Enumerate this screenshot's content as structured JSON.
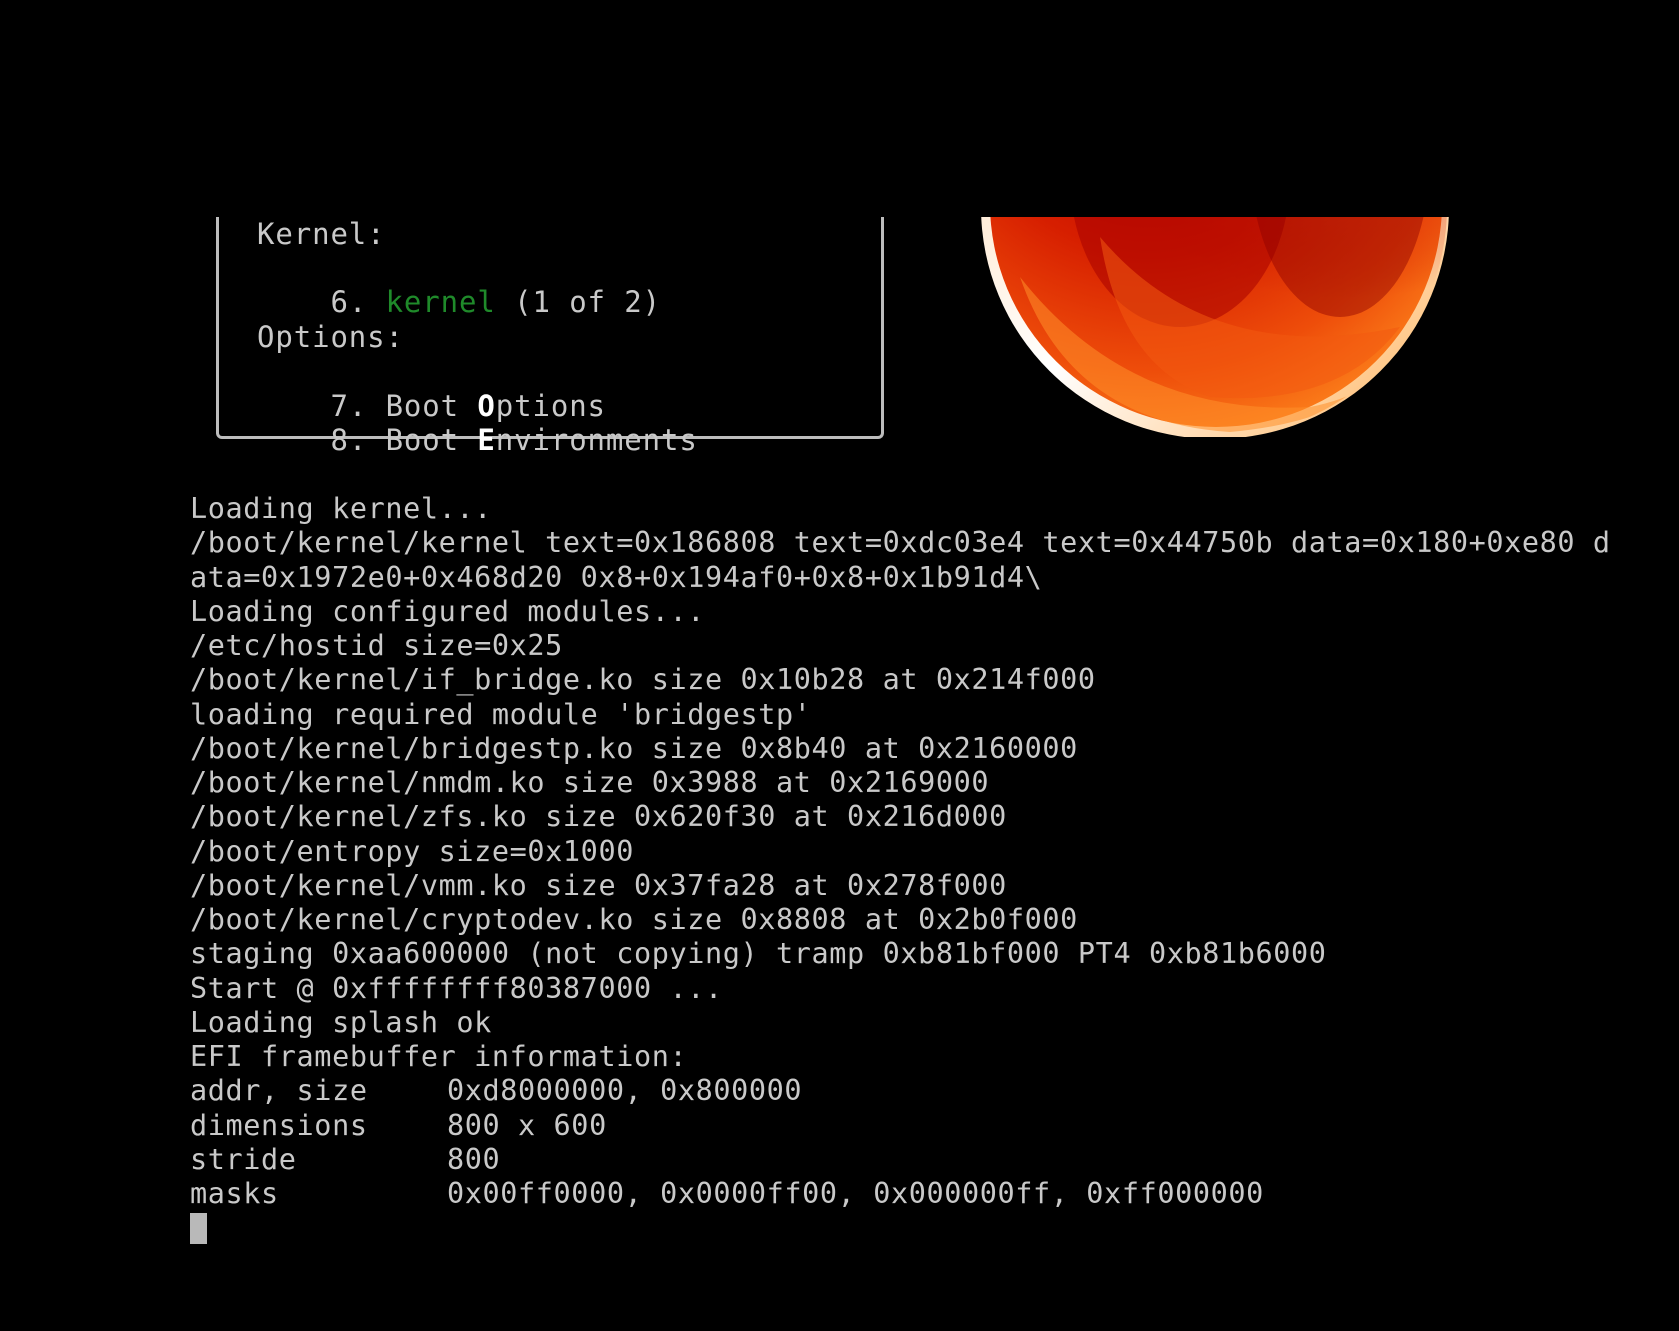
{
  "menu": {
    "kernel_heading": "Kernel:",
    "kernel_item": {
      "number": "6.",
      "name": "kernel",
      "suffix": "(1 of 2)"
    },
    "options_heading": "Options:",
    "items": [
      {
        "number": "7.",
        "prefix": "Boot ",
        "hotkey": "O",
        "rest": "ptions"
      },
      {
        "number": "8.",
        "prefix": "Boot ",
        "hotkey": "E",
        "rest": "nvironments"
      }
    ]
  },
  "console": {
    "lines": [
      "Loading kernel...",
      "/boot/kernel/kernel text=0x186808 text=0xdc03e4 text=0x44750b data=0x180+0xe80 d",
      "ata=0x1972e0+0x468d20 0x8+0x194af0+0x8+0x1b91d4\\",
      "Loading configured modules...",
      "/etc/hostid size=0x25",
      "/boot/kernel/if_bridge.ko size 0x10b28 at 0x214f000",
      "loading required module 'bridgestp'",
      "/boot/kernel/bridgestp.ko size 0x8b40 at 0x2160000",
      "/boot/kernel/nmdm.ko size 0x3988 at 0x2169000",
      "/boot/kernel/zfs.ko size 0x620f30 at 0x216d000",
      "/boot/entropy size=0x1000",
      "/boot/kernel/vmm.ko size 0x37fa28 at 0x278f000",
      "/boot/kernel/cryptodev.ko size 0x8808 at 0x2b0f000",
      "staging 0xaa600000 (not copying) tramp 0xb81bf000 PT4 0xb81b6000",
      "Start @ 0xffffffff80387000 ...",
      "Loading splash ok",
      "EFI framebuffer information:"
    ],
    "framebuffer": [
      {
        "key": "addr, size",
        "value": "0xd8000000, 0x800000"
      },
      {
        "key": "dimensions",
        "value": "800 x 600"
      },
      {
        "key": "stride",
        "value": "800"
      },
      {
        "key": "masks",
        "value": "0x00ff0000, 0x0000ff00, 0x000000ff, 0xff000000"
      }
    ]
  },
  "colors": {
    "background": "#000000",
    "text": "#c9c9c9",
    "highlight": "#ffffff",
    "kernel_name": "#1f8a2a",
    "logo_red": "#d31d00",
    "logo_orange": "#ff7a1a"
  },
  "icons": {
    "logo": "red-orange-sphere-logo"
  }
}
